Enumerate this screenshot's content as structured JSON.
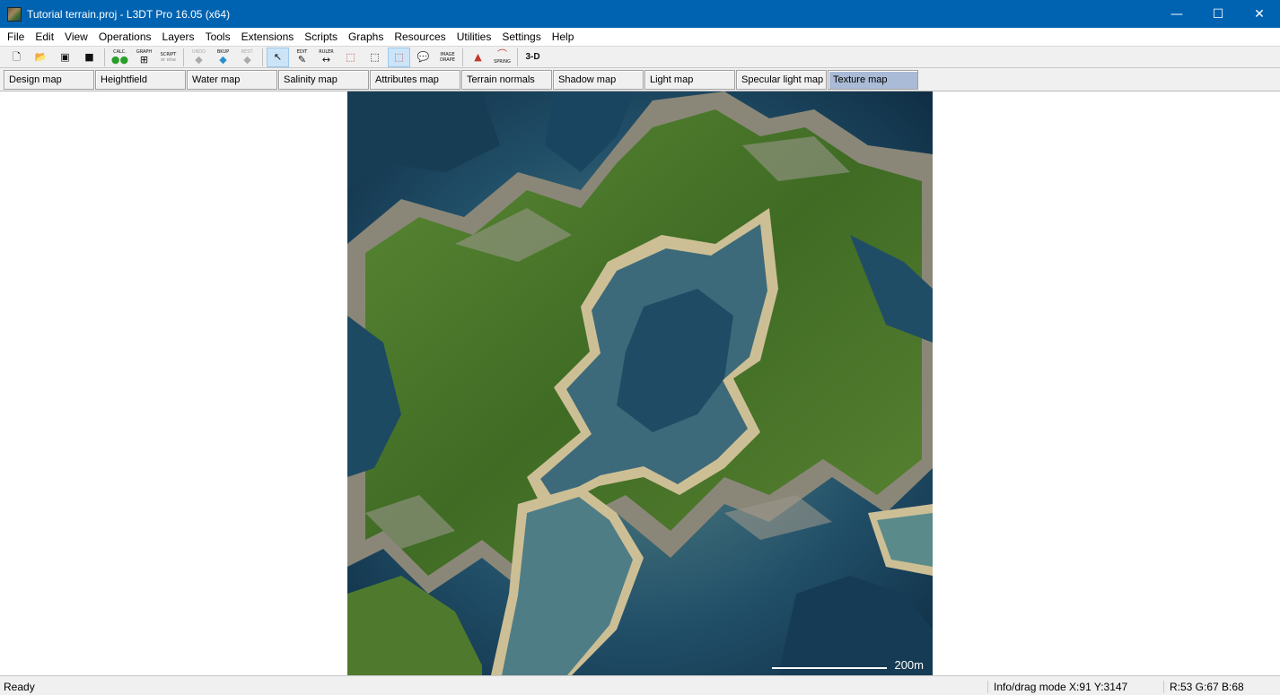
{
  "window": {
    "title": "Tutorial terrain.proj - L3DT Pro 16.05 (x64)",
    "minimize": "—",
    "maximize": "☐",
    "close": "✕"
  },
  "menu": [
    "File",
    "Edit",
    "View",
    "Operations",
    "Layers",
    "Tools",
    "Extensions",
    "Scripts",
    "Graphs",
    "Resources",
    "Utilities",
    "Settings",
    "Help"
  ],
  "toolbar": {
    "calc": "CALC.",
    "graph": "GRAPH",
    "script": "SCRIPT",
    "script_sub": "or else",
    "undo": "UNDO",
    "bkup": "BKUP",
    "rest": "REST.",
    "edit": "EDIT",
    "ruler": "RULER",
    "image_drape_1": "IMAGE",
    "image_drape_2": "DRAPE",
    "spring": "SPRING",
    "three_d": "3-D"
  },
  "tabs": [
    "Design map",
    "Heightfield",
    "Water map",
    "Salinity map",
    "Attributes map",
    "Terrain normals",
    "Shadow map",
    "Light map",
    "Specular light map",
    "Texture map"
  ],
  "active_tab": "Texture map",
  "scale_label": "200m",
  "status": {
    "ready": "Ready",
    "info": "Info/drag mode X:91 Y:3147",
    "rgb": "R:53 G:67 B:68"
  },
  "colors": {
    "titlebar": "#0063b1",
    "tab_selected": "#a9bbd6",
    "water_deep": "#12384f",
    "grass": "#4f7a2e",
    "rock": "#8a8a80",
    "sand": "#cdbf95"
  }
}
